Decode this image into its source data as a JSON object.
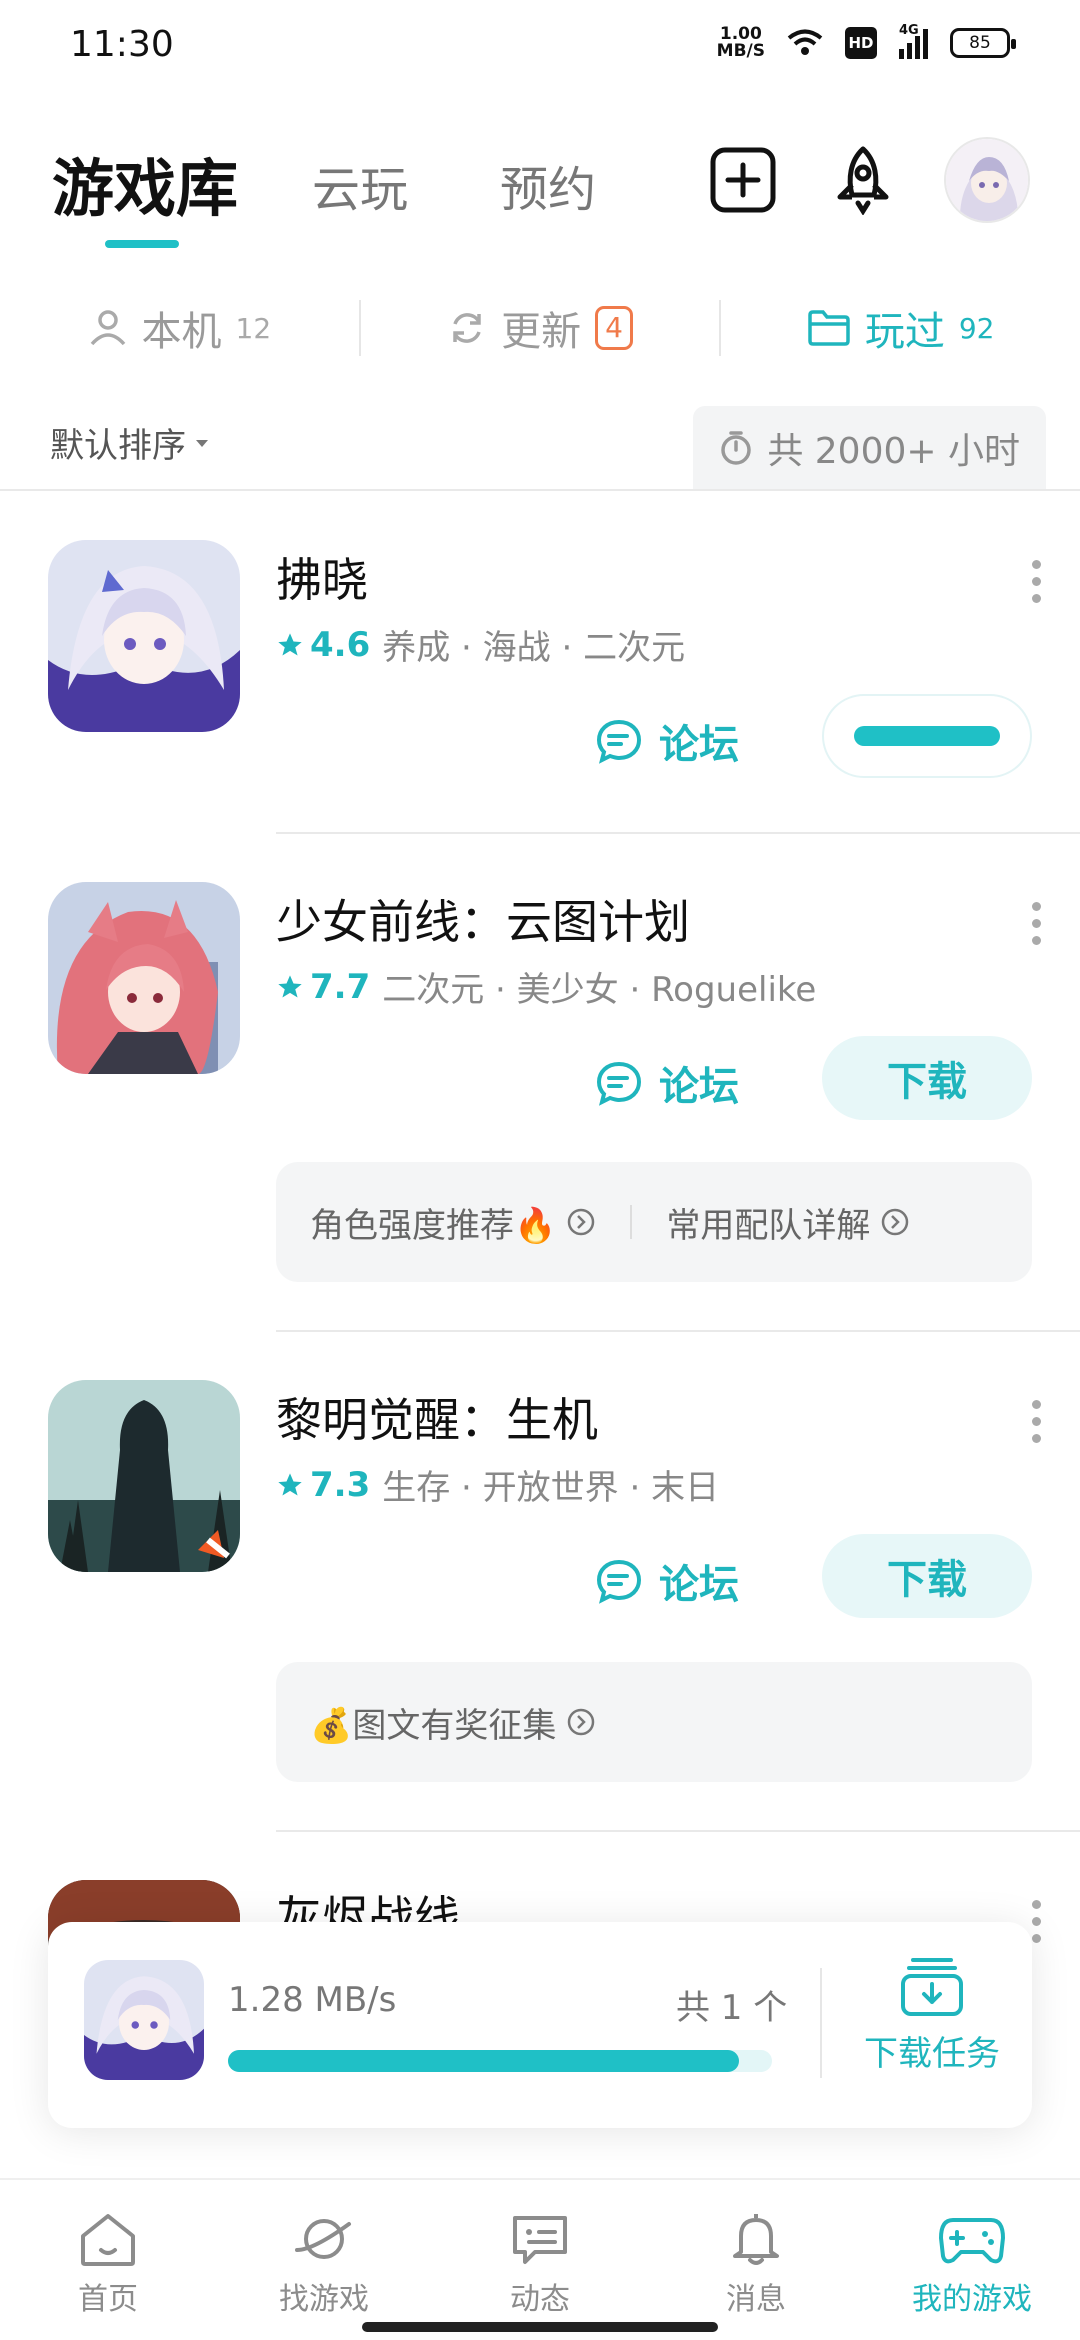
{
  "status": {
    "time": "11:30",
    "net_speed_value": "1.00",
    "net_speed_unit": "MB/S",
    "hd": "HD",
    "network": "4G",
    "battery": "85"
  },
  "header": {
    "tabs": [
      "游戏库",
      "云玩",
      "预约"
    ],
    "add_icon": "plus-square-icon",
    "rocket_icon": "rocket-icon"
  },
  "filters": {
    "local": {
      "label": "本机",
      "count": "12"
    },
    "update": {
      "label": "更新",
      "count": "4"
    },
    "played": {
      "label": "玩过",
      "count": "92"
    }
  },
  "sort": {
    "label": "默认排序"
  },
  "total_time": "共 2000+ 小时",
  "games": [
    {
      "name": "拂晓",
      "rating": "4.6",
      "tags": "养成 · 海战 · 二次元",
      "forum": "论坛"
    },
    {
      "name": "少女前线：云图计划",
      "rating": "7.7",
      "tags": "二次元 · 美少女 · Roguelike",
      "forum": "论坛",
      "action": "下载",
      "tips": [
        "角色强度推荐🔥",
        "常用配队详解"
      ]
    },
    {
      "name": "黎明觉醒：生机",
      "rating": "7.3",
      "tags": "生存 · 开放世界 · 末日",
      "forum": "论坛",
      "action": "下载",
      "tips": [
        "💰图文有奖征集"
      ]
    },
    {
      "name": "灰烬战线"
    }
  ],
  "download_panel": {
    "speed": "1.28 MB/s",
    "count": "共 1 个",
    "progress": 0.94,
    "task_label": "下载任务"
  },
  "nav": [
    {
      "label": "首页",
      "icon": "home-icon"
    },
    {
      "label": "找游戏",
      "icon": "planet-icon"
    },
    {
      "label": "动态",
      "icon": "message-icon"
    },
    {
      "label": "消息",
      "icon": "bell-icon"
    },
    {
      "label": "我的游戏",
      "icon": "gamepad-icon"
    }
  ],
  "colors": {
    "accent": "#1fb5bd",
    "badge": "#f07a4a"
  }
}
